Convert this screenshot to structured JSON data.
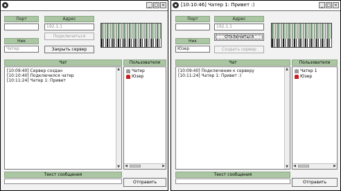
{
  "left": {
    "labels": {
      "port": "Порт",
      "address": "Адрес",
      "nick": "Ник"
    },
    "port_value": "",
    "address_value": "192.1.1",
    "nick_value": "Чатер",
    "connect_button": "Подключиться",
    "server_button": "Закрыть сервер",
    "chat_header": "Чат",
    "users_header": "Пользователи",
    "chat_lines": [
      "[10:09:40] Сервер создан",
      "[10:10:40] Подключился чатер",
      "[10:11:24] Чатер 1: Привет"
    ],
    "users": [
      {
        "name": "Чатер",
        "icon": "grey-user-icon"
      },
      {
        "name": "Юзер",
        "icon": "red-user-icon"
      }
    ],
    "message_header": "Текст сообщения",
    "send_button": "Отправить"
  },
  "right": {
    "title": "[10:10:46] Чатер 1: Привет :)",
    "labels": {
      "port": "Порт",
      "address": "Адрес",
      "nick": "Ник"
    },
    "port_value": "",
    "address_value": "192.1.1",
    "nick_value": "Юзер",
    "connect_button": "Отключиться",
    "server_button": "Создать сервер",
    "chat_header": "Чат",
    "users_header": "Пользователи",
    "chat_lines": [
      "[10:09:40] Подключение к серверу",
      "[10:11:24] Чатер 1: Привет :)"
    ],
    "users": [
      {
        "name": "Чатер 1",
        "icon": "grey-user-icon"
      },
      {
        "name": "Юзер",
        "icon": "red-user-icon"
      }
    ],
    "message_header": "Текст сообщения",
    "send_button": "Отправить"
  }
}
